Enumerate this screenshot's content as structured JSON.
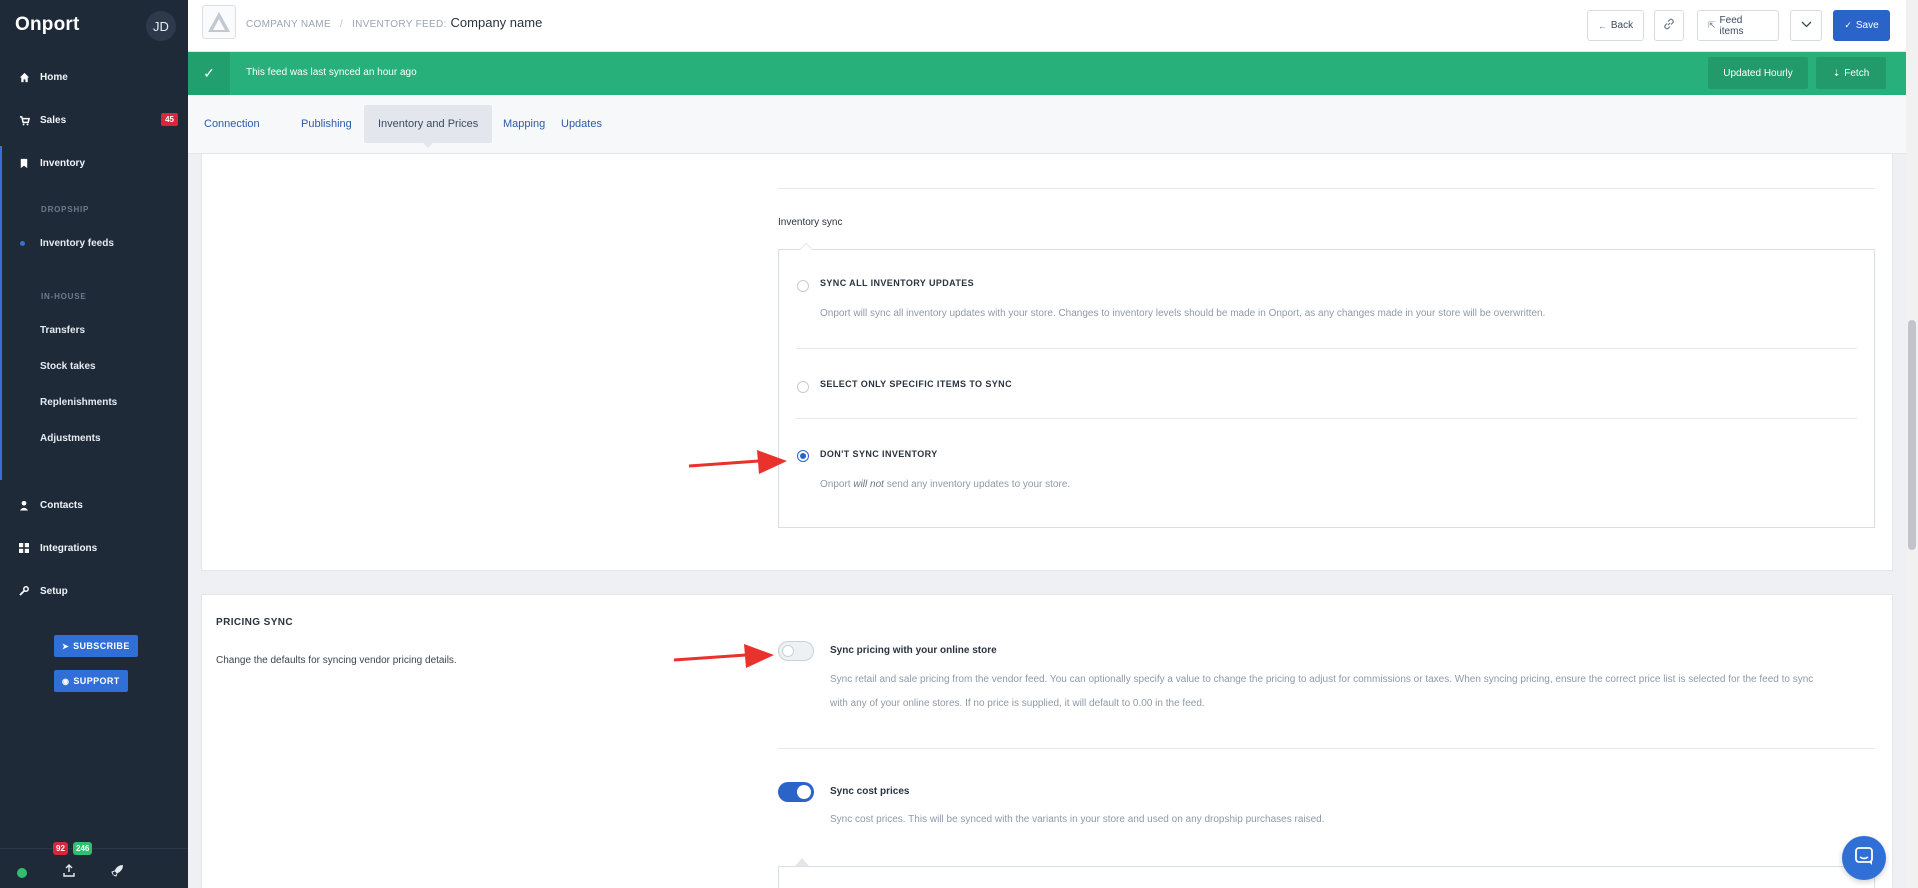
{
  "app": {
    "brand": "Onport",
    "avatar_initials": "JD"
  },
  "sidebar": {
    "items": [
      {
        "label": "Home",
        "icon": "home-icon"
      },
      {
        "label": "Sales",
        "icon": "cart-icon",
        "badge": "45"
      },
      {
        "label": "Inventory",
        "icon": "bookmark-icon"
      },
      {
        "label": "Contacts",
        "icon": "user-icon"
      },
      {
        "label": "Integrations",
        "icon": "grid-icon"
      },
      {
        "label": "Setup",
        "icon": "wrench-icon"
      }
    ],
    "dropship_label": "DROPSHIP",
    "inventory_feeds": "Inventory feeds",
    "inhouse_label": "IN-HOUSE",
    "inhouse_items": [
      "Transfers",
      "Stock takes",
      "Replenishments",
      "Adjustments"
    ],
    "subscribe_label": "SUBSCRIBE",
    "support_label": "SUPPORT",
    "footer": {
      "badge_red": "92",
      "badge_green": "246"
    }
  },
  "header": {
    "crumb_company": "COMPANY NAME",
    "crumb_sep": "/",
    "crumb_feed": "INVENTORY FEED:",
    "company_name": "Company name",
    "back_label": "Back",
    "feed_items_label": "Feed items",
    "save_label": "Save"
  },
  "banner": {
    "message": "This feed was last synced an hour ago",
    "schedule_label": "Updated Hourly",
    "fetch_label": "Fetch",
    "color": "#27b07a"
  },
  "tabs": [
    "Connection",
    "Publishing",
    "Inventory and Prices",
    "Mapping",
    "Updates"
  ],
  "active_tab": "Inventory and Prices",
  "inventory_sync": {
    "title": "Inventory sync",
    "options": [
      {
        "label": "SYNC ALL INVENTORY UPDATES",
        "desc": "Onport will sync all inventory updates with your store. Changes to inventory levels should be made in Onport, as any changes made in your store will be overwritten."
      },
      {
        "label": "SELECT ONLY SPECIFIC ITEMS TO SYNC",
        "desc": ""
      },
      {
        "label": "DON'T SYNC INVENTORY",
        "desc_pre": "Onport ",
        "desc_em": "will not",
        "desc_post": " send any inventory updates to your store."
      }
    ],
    "selected_index": 2
  },
  "pricing_sync": {
    "heading": "PRICING SYNC",
    "description": "Change the defaults for syncing vendor pricing details.",
    "toggles": [
      {
        "label": "Sync pricing with your online store",
        "desc_line1": "Sync retail and sale pricing from the vendor feed. You can optionally specify a value to change the pricing to adjust for commissions or taxes. When syncing pricing, ensure the correct price list is selected for the feed to sync",
        "desc_line2": "with any of your online stores. If no price is supplied, it will default to 0.00 in the feed.",
        "on": false
      },
      {
        "label": "Sync cost prices",
        "desc_line1": "Sync cost prices. This will be synced with the variants in your store and used on any dropship purchases raised.",
        "on": true
      }
    ]
  },
  "colors": {
    "accent": "#2a64c8",
    "sidebar": "#1f2a38",
    "annotation_arrow": "#e8322b"
  }
}
